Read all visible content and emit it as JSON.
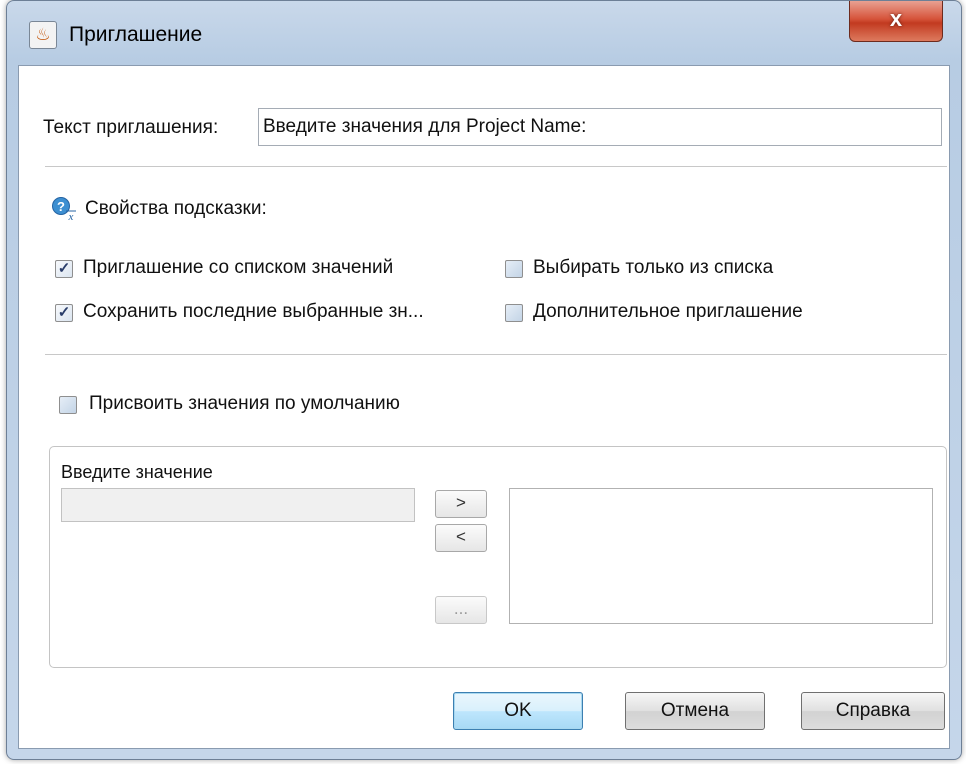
{
  "window": {
    "title": "Приглашение",
    "app_icon": "java-cup-icon",
    "close_label": "x"
  },
  "prompt": {
    "label": "Текст приглашения:",
    "value": "Введите значения для Project Name:"
  },
  "hint": {
    "icon": "hint-question-icon",
    "label": "Свойства подсказки:"
  },
  "checkboxes": {
    "list_prompt": {
      "label": "Приглашение со списком значений",
      "checked": true
    },
    "select_only": {
      "label": "Выбирать только из списка",
      "checked": false
    },
    "keep_last": {
      "label": "Сохранить последние выбранные зн...",
      "checked": true
    },
    "optional": {
      "label": "Дополнительное приглашение",
      "checked": false
    },
    "defaults": {
      "label": "Присвоить значения по умолчанию",
      "checked": false
    }
  },
  "values_group": {
    "input_label": "Введите значение",
    "add_label": ">",
    "remove_label": "<",
    "browse_label": "..."
  },
  "buttons": {
    "ok": "OK",
    "cancel": "Отмена",
    "help": "Справка"
  }
}
